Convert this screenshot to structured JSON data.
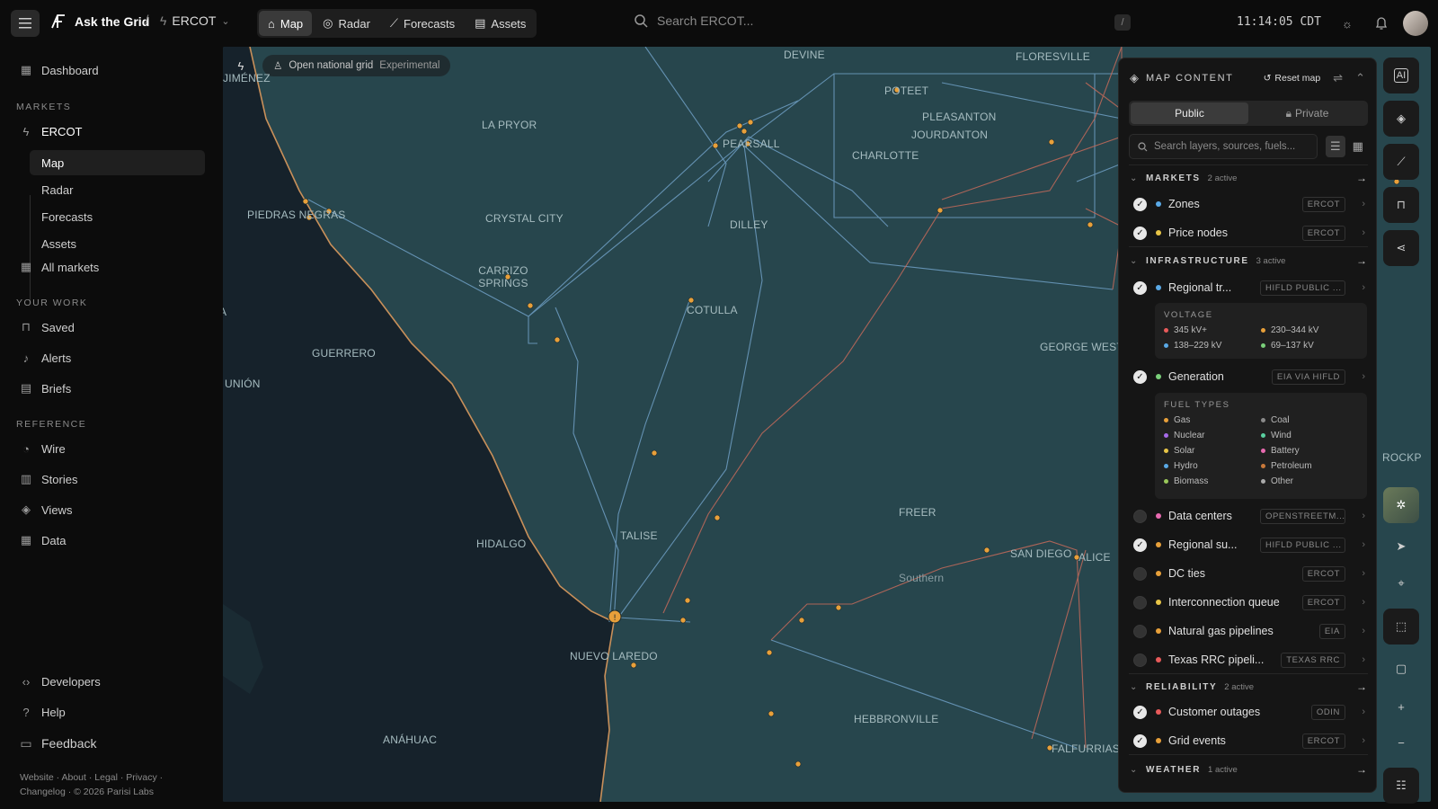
{
  "topbar": {
    "brand": "Ask the Grid",
    "market": "ERCOT",
    "tabs": [
      {
        "label": "Map",
        "icon": "map-icon",
        "active": true
      },
      {
        "label": "Radar",
        "icon": "radar-icon",
        "active": false
      },
      {
        "label": "Forecasts",
        "icon": "chart-icon",
        "active": false
      },
      {
        "label": "Assets",
        "icon": "assets-icon",
        "active": false
      }
    ],
    "search_placeholder": "Search ERCOT...",
    "shortcut": "/",
    "clock": "11:14:05 CDT"
  },
  "sidebar": {
    "dashboard": "Dashboard",
    "markets_header": "MARKETS",
    "ercot": "ERCOT",
    "ercot_sub": [
      "Map",
      "Radar",
      "Forecasts",
      "Assets"
    ],
    "all_markets": "All markets",
    "your_work_header": "YOUR WORK",
    "saved": "Saved",
    "alerts": "Alerts",
    "briefs": "Briefs",
    "reference_header": "REFERENCE",
    "wire": "Wire",
    "stories": "Stories",
    "views": "Views",
    "data": "Data",
    "developers": "Developers",
    "help": "Help",
    "feedback": "Feedback",
    "footer1": "Website · About · Legal · Privacy ·",
    "footer2": "Changelog · © 2026 Parisi Labs"
  },
  "map": {
    "chip_label": "Open national grid",
    "chip_badge": "Experimental",
    "labels": [
      "JIMÉNEZ",
      "LA PRYOR",
      "DEVINE",
      "FLORESVILLE",
      "POTEET",
      "PLEASANTON",
      "JOURDANTON",
      "PEARSALL",
      "CHARLOTTE",
      "PIEDRAS NEGRAS",
      "CRYSTAL CITY",
      "DILLEY",
      "CARRIZO SPRINGS",
      "COTULLA",
      "GUERRERO",
      "UNIÓN",
      "GEORGE WEST",
      "FREER",
      "HIDALGO",
      "TALISE",
      "SAN DIEGO",
      "ALICE",
      "Southern",
      "NUEVO LAREDO",
      "HEBBRONVILLE",
      "ANÁHUAC",
      "FALFURRIAS",
      "A",
      "ROCKP"
    ]
  },
  "panel": {
    "title": "MAP CONTENT",
    "reset": "Reset map",
    "seg_public": "Public",
    "seg_private": "Private",
    "search_placeholder": "Search layers, sources, fuels...",
    "sections": {
      "markets": {
        "name": "MARKETS",
        "count": "2 active"
      },
      "infrastructure": {
        "name": "INFRASTRUCTURE",
        "count": "3 active"
      },
      "reliability": {
        "name": "RELIABILITY",
        "count": "2 active"
      },
      "weather": {
        "name": "WEATHER",
        "count": "1 active"
      }
    },
    "layers": [
      {
        "name": "Zones",
        "tag": "ERCOT",
        "on": true,
        "color": "#5aa9e6"
      },
      {
        "name": "Price nodes",
        "tag": "ERCOT",
        "on": true,
        "color": "#e8c547"
      },
      {
        "name": "Regional tr...",
        "tag": "HIFLD PUBLIC ...",
        "on": true,
        "color": "#5aa9e6"
      },
      {
        "name": "Generation",
        "tag": "EIA VIA HIFLD",
        "on": true,
        "color": "#7ad07a"
      },
      {
        "name": "Data centers",
        "tag": "OPENSTREETM...",
        "on": false,
        "color": "#e86ab0"
      },
      {
        "name": "Regional su...",
        "tag": "HIFLD PUBLIC ...",
        "on": true,
        "color": "#e8a03a"
      },
      {
        "name": "DC ties",
        "tag": "ERCOT",
        "on": false,
        "color": "#e8a03a"
      },
      {
        "name": "Interconnection queue",
        "tag": "ERCOT",
        "on": false,
        "color": "#e8c547"
      },
      {
        "name": "Natural gas pipelines",
        "tag": "EIA",
        "on": false,
        "color": "#e8a03a"
      },
      {
        "name": "Texas RRC pipeli...",
        "tag": "TEXAS RRC",
        "on": false,
        "color": "#e85a5a"
      },
      {
        "name": "Customer outages",
        "tag": "ODIN",
        "on": true,
        "color": "#e85a5a"
      },
      {
        "name": "Grid events",
        "tag": "ERCOT",
        "on": true,
        "color": "#e8a03a"
      }
    ],
    "voltage": {
      "title": "VOLTAGE",
      "items": [
        {
          "label": "345 kV+",
          "color": "#e85a5a"
        },
        {
          "label": "230–344 kV",
          "color": "#e8a03a"
        },
        {
          "label": "138–229 kV",
          "color": "#5aa9e6"
        },
        {
          "label": "69–137 kV",
          "color": "#7ad07a"
        }
      ]
    },
    "fuel": {
      "title": "FUEL TYPES",
      "items": [
        {
          "label": "Gas",
          "color": "#e8a03a"
        },
        {
          "label": "Coal",
          "color": "#8a8a8a"
        },
        {
          "label": "Nuclear",
          "color": "#a66ae8"
        },
        {
          "label": "Wind",
          "color": "#5ad0a0"
        },
        {
          "label": "Solar",
          "color": "#e8c547"
        },
        {
          "label": "Battery",
          "color": "#e86ab0"
        },
        {
          "label": "Hydro",
          "color": "#5aa9e6"
        },
        {
          "label": "Petroleum",
          "color": "#c8783a"
        },
        {
          "label": "Biomass",
          "color": "#9ac85a"
        },
        {
          "label": "Other",
          "color": "#aaaaaa"
        }
      ]
    }
  }
}
